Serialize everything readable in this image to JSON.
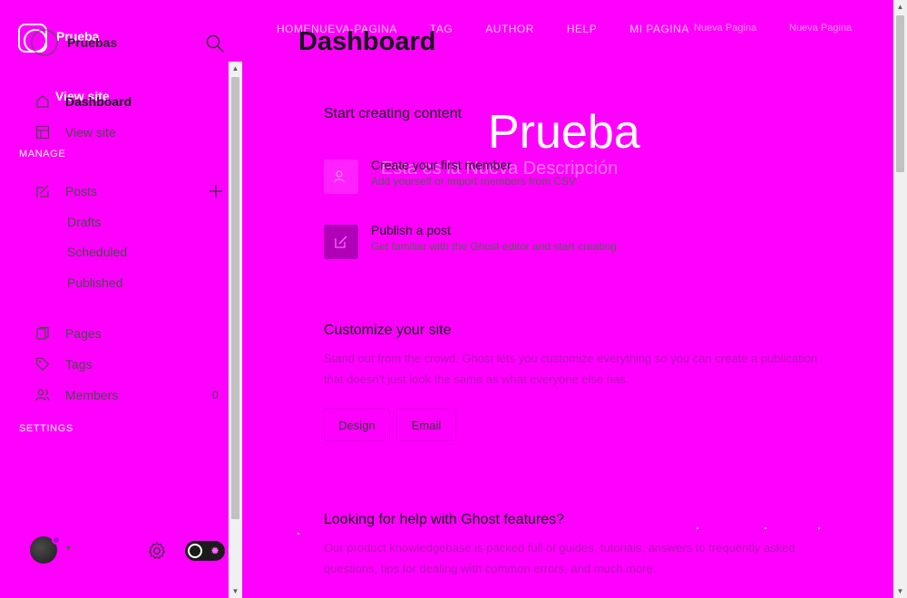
{
  "site_bg": {
    "nav": [
      "HOMENUEVA-PAGINA",
      "TAG",
      "AUTHOR",
      "HELP",
      "MI PAGINA"
    ],
    "nav_right": [
      "Nueva Pagina",
      "Nueva Pagina"
    ],
    "hero_title": "Prueba",
    "hero_description": "Esta es la Nueva Descripción",
    "brand": "Prueba",
    "view_site": "View site"
  },
  "sidebar": {
    "brand_name": "Pruebas",
    "sections": {
      "manage": "MANAGE",
      "settings": "SETTINGS"
    },
    "items": [
      {
        "label": "Dashboard",
        "icon": "home-icon"
      },
      {
        "label": "View site",
        "icon": "layout-icon"
      },
      {
        "label": "Posts",
        "icon": "posts-icon"
      },
      {
        "label": "Drafts"
      },
      {
        "label": "Scheduled"
      },
      {
        "label": "Published"
      },
      {
        "label": "Pages",
        "icon": "pages-icon"
      },
      {
        "label": "Tags",
        "icon": "tag-icon"
      },
      {
        "label": "Members",
        "icon": "members-icon",
        "count": "0"
      }
    ]
  },
  "main": {
    "title": "Dashboard",
    "start": {
      "heading": "Start creating content",
      "tasks": [
        {
          "title": "Create your first member",
          "subtitle": "Add yourself or import members from CSV",
          "icon": "members-icon",
          "color": "#ff22ff"
        },
        {
          "title": "Publish a post",
          "subtitle": "Get familiar with the Ghost editor and start creating",
          "icon": "edit-icon",
          "color": "#b000b8"
        }
      ]
    },
    "customize": {
      "heading": "Customize your site",
      "text": "Stand out from the crowd. Ghost lets you customize everything so you can create a publication that doesn't just look the same as what everyone else has.",
      "buttons": [
        "Design",
        "Email"
      ]
    },
    "help": {
      "heading": "Looking for help with Ghost features?",
      "text": "Our product knowledgebase is packed full of guides, tutorials, answers to frequently asked questions, tips for dealing with common errors, and much more."
    }
  },
  "colors": {
    "background": "#ff00ff",
    "accent": "#b000b8"
  }
}
